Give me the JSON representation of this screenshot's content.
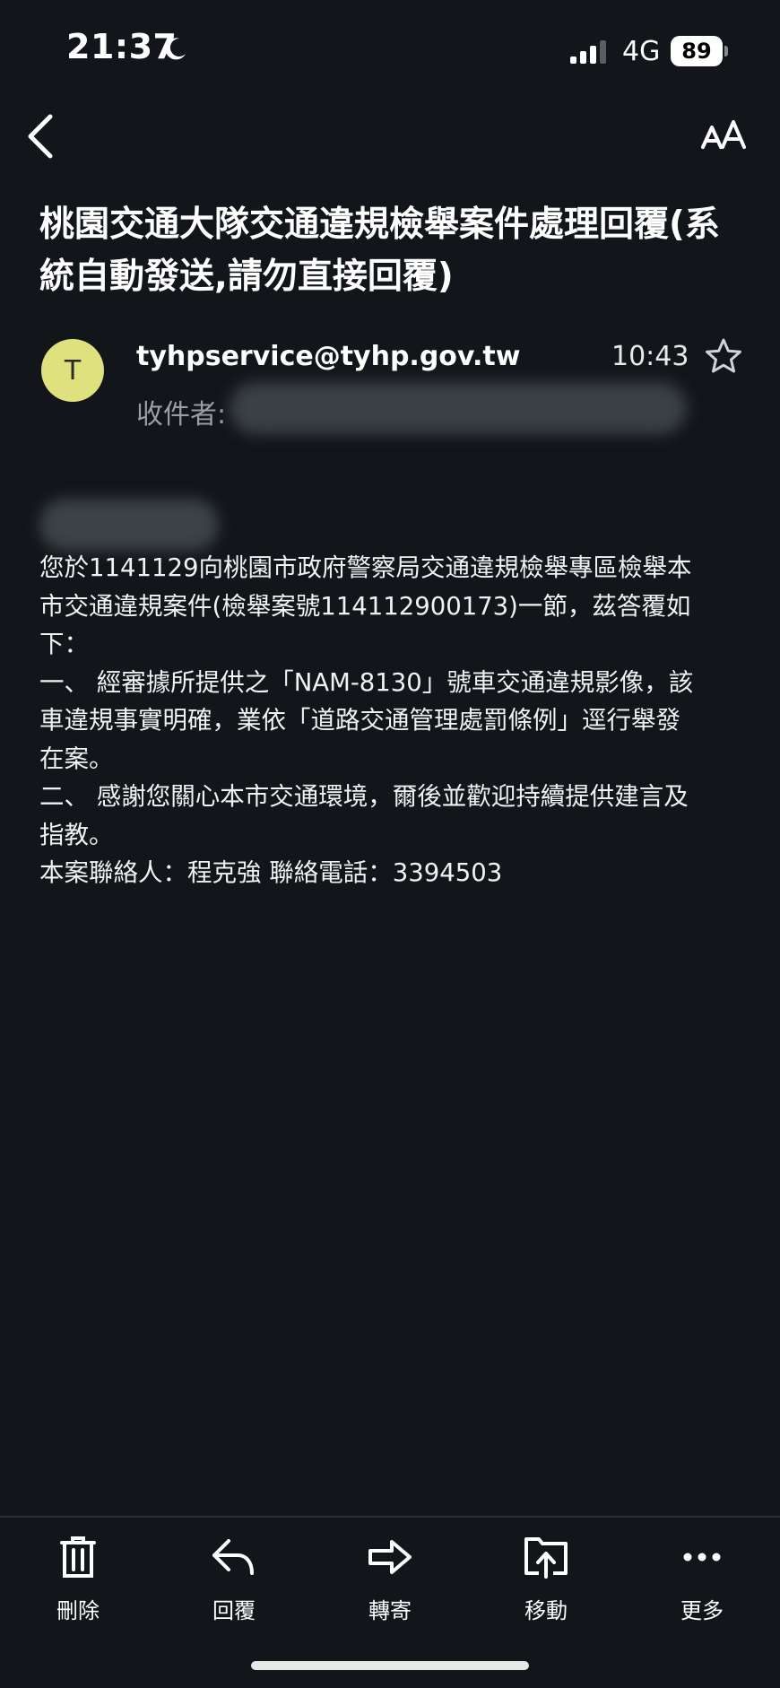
{
  "status_bar": {
    "time": "21:37",
    "network": "4G",
    "battery": "89"
  },
  "email": {
    "subject": "桃園交通大隊交通違規檢舉案件處理回覆(系統自動發送,請勿直接回覆)",
    "avatar_initial": "T",
    "sender": "tyhpservice@tyhp.gov.tw",
    "time": "10:43",
    "recipient_label": "收件者:",
    "body_lines": [
      "您於1141129向桃園市政府警察局交通違規檢舉專區檢舉本",
      "市交通違規案件(檢舉案號114112900173)一節，茲答覆如",
      "下：",
      "一、 經審據所提供之「NAM-8130」號車交通違規影像，該",
      "車違規事實明確，業依「道路交通管理處罰條例」逕行舉發",
      "在案。",
      "二、 感謝您關心本市交通環境，爾後並歡迎持續提供建言及",
      "指教。",
      "本案聯絡人：程克強 聯絡電話：3394503"
    ]
  },
  "toolbar": {
    "delete": "刪除",
    "reply": "回覆",
    "forward": "轉寄",
    "move": "移動",
    "more": "更多"
  },
  "colors": {
    "background": "#12161a",
    "avatar": "#dfe17e"
  }
}
